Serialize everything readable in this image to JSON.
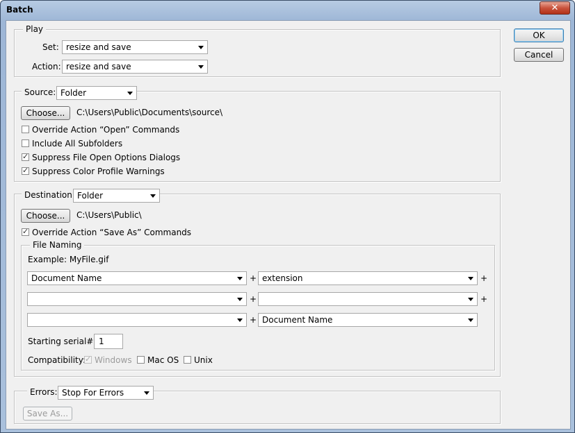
{
  "window": {
    "title": "Batch",
    "close_glyph": "✕"
  },
  "buttons": {
    "ok": "OK",
    "cancel": "Cancel"
  },
  "play": {
    "legend": "Play",
    "set_label": "Set:",
    "set_value": "resize and save",
    "action_label": "Action:",
    "action_value": "resize and save"
  },
  "source": {
    "label": "Source:",
    "value": "Folder",
    "choose": "Choose...",
    "path": "C:\\Users\\Public\\Documents\\source\\",
    "options": [
      {
        "label": "Override Action “Open” Commands",
        "checked": false
      },
      {
        "label": "Include All Subfolders",
        "checked": false
      },
      {
        "label": "Suppress File Open Options Dialogs",
        "checked": true
      },
      {
        "label": "Suppress Color Profile Warnings",
        "checked": true
      }
    ]
  },
  "destination": {
    "label": "Destination:",
    "value": "Folder",
    "choose": "Choose...",
    "path": "C:\\Users\\Public\\",
    "override_label": "Override Action “Save As” Commands",
    "override_checked": true
  },
  "file_naming": {
    "legend": "File Naming",
    "example": "Example: MyFile.gif",
    "fields": [
      {
        "left": "Document Name",
        "right": "extension"
      },
      {
        "left": "",
        "right": ""
      },
      {
        "left": "",
        "right": "Document Name"
      }
    ],
    "plus": "+",
    "serial_label": "Starting serial#:",
    "serial_value": "1",
    "compat_label": "Compatibility:",
    "compat": [
      {
        "label": "Windows",
        "checked": true,
        "disabled": true
      },
      {
        "label": "Mac OS",
        "checked": false,
        "disabled": false
      },
      {
        "label": "Unix",
        "checked": false,
        "disabled": false
      }
    ]
  },
  "errors": {
    "label": "Errors:",
    "value": "Stop For Errors",
    "save_as": "Save As..."
  }
}
